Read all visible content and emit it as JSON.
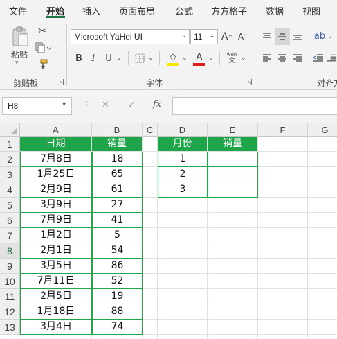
{
  "ribbon_tabs": [
    "文件",
    "开始",
    "插入",
    "页面布局",
    "公式",
    "方方格子",
    "数据",
    "视图"
  ],
  "active_tab": "开始",
  "clipboard": {
    "paste_label": "粘贴",
    "group_label": "剪贴板"
  },
  "font": {
    "family": "Microsoft YaHei UI",
    "size": "11",
    "group_label": "字体",
    "phonetic_label": "wén"
  },
  "alignment": {
    "group_label": "对齐方"
  },
  "formula_bar": {
    "name_box": "H8",
    "fx": "fx",
    "cancel": "✕",
    "enter": "✓"
  },
  "columns": [
    "A",
    "B",
    "C",
    "D",
    "E",
    "F",
    "G"
  ],
  "rows": [
    "1",
    "2",
    "3",
    "4",
    "5",
    "6",
    "7",
    "8",
    "9",
    "10",
    "11",
    "12",
    "13"
  ],
  "selected_row": "8",
  "sales_table": {
    "headers": [
      "日期",
      "销量"
    ],
    "rows": [
      [
        "7月8日",
        "18"
      ],
      [
        "1月25日",
        "65"
      ],
      [
        "2月9日",
        "61"
      ],
      [
        "3月9日",
        "27"
      ],
      [
        "7月9日",
        "41"
      ],
      [
        "1月2日",
        "5"
      ],
      [
        "2月1日",
        "54"
      ],
      [
        "3月5日",
        "86"
      ],
      [
        "7月11日",
        "52"
      ],
      [
        "2月5日",
        "19"
      ],
      [
        "1月18日",
        "88"
      ],
      [
        "3月4日",
        "74"
      ]
    ]
  },
  "summary_table": {
    "headers": [
      "月份",
      "销量"
    ],
    "rows": [
      [
        "1",
        ""
      ],
      [
        "2",
        ""
      ],
      [
        "3",
        ""
      ]
    ]
  },
  "colors": {
    "accent": "#217346",
    "header_fill": "#1ea54a",
    "font_color": "#e02020",
    "highlight": "#f5e600"
  }
}
